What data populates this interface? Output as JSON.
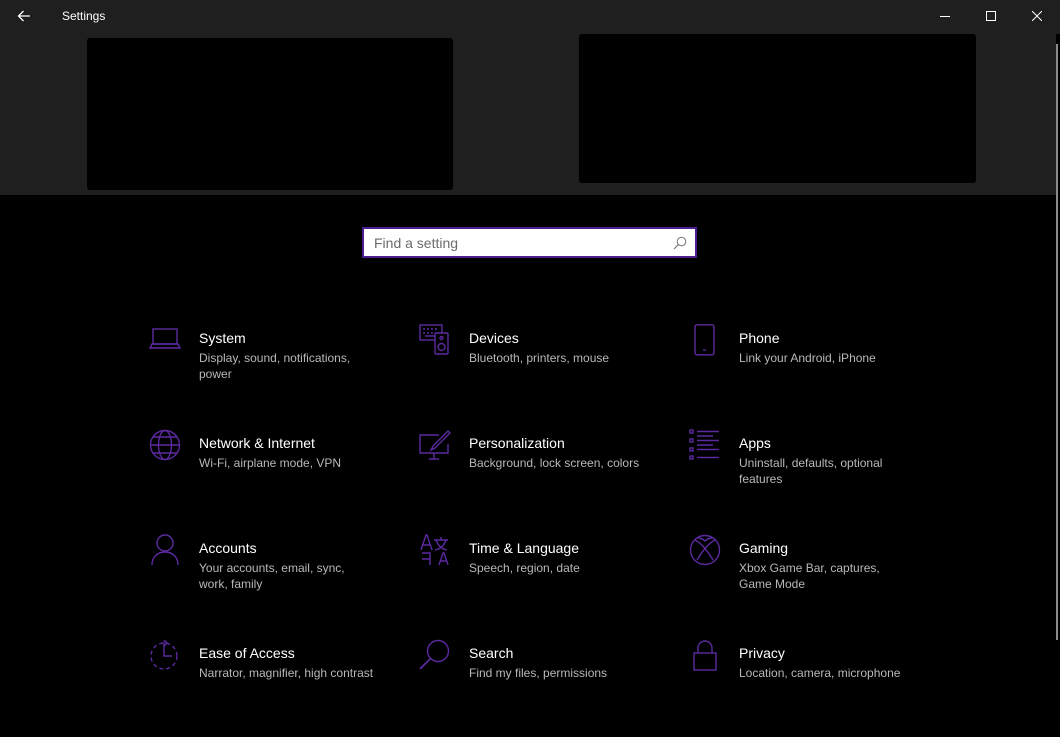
{
  "window": {
    "title": "Settings"
  },
  "search": {
    "placeholder": "Find a setting"
  },
  "colors": {
    "accent": "#4b1d8e",
    "background": "#000000",
    "header": "#1f1f1f"
  },
  "categories": [
    {
      "title": "System",
      "description": "Display, sound, notifications, power",
      "icon": "laptop-icon"
    },
    {
      "title": "Devices",
      "description": "Bluetooth, printers, mouse",
      "icon": "devices-icon"
    },
    {
      "title": "Phone",
      "description": "Link your Android, iPhone",
      "icon": "phone-icon"
    },
    {
      "title": "Network & Internet",
      "description": "Wi-Fi, airplane mode, VPN",
      "icon": "globe-icon"
    },
    {
      "title": "Personalization",
      "description": "Background, lock screen, colors",
      "icon": "paintbrush-icon"
    },
    {
      "title": "Apps",
      "description": "Uninstall, defaults, optional features",
      "icon": "apps-list-icon"
    },
    {
      "title": "Accounts",
      "description": "Your accounts, email, sync, work, family",
      "icon": "person-icon"
    },
    {
      "title": "Time & Language",
      "description": "Speech, region, date",
      "icon": "time-language-icon"
    },
    {
      "title": "Gaming",
      "description": "Xbox Game Bar, captures, Game Mode",
      "icon": "xbox-icon"
    },
    {
      "title": "Ease of Access",
      "description": "Narrator, magnifier, high contrast",
      "icon": "ease-of-access-icon"
    },
    {
      "title": "Search",
      "description": "Find my files, permissions",
      "icon": "search-icon"
    },
    {
      "title": "Privacy",
      "description": "Location, camera, microphone",
      "icon": "lock-icon"
    }
  ]
}
